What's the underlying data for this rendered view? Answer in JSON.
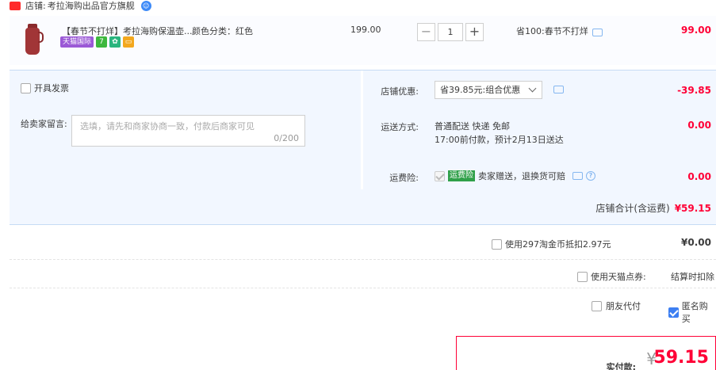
{
  "store": {
    "label": "店铺:",
    "name": "考拉海购出品官方旗舰",
    "ww_icon": "chat-bubble-icon"
  },
  "item": {
    "title": "【春节不打烊】考拉海购保温壶...",
    "sku": "颜色分类：红色",
    "tags": {
      "tmall_intl": "天猫国际",
      "seven": "7",
      "green": "✿",
      "yellow": "▭"
    },
    "price": "199.00",
    "qty": "1",
    "minus": "−",
    "plus": "+",
    "promo": "省100:春节不打烊",
    "subtotal": "99.00"
  },
  "options": {
    "invoice_label": "开具发票",
    "message_label": "给卖家留言:",
    "message_placeholder": "选填，请先和商家协商一致，付款后商家可见",
    "message_count": "0/200",
    "store_coupon_label": "店铺优惠:",
    "store_coupon_value": "省39.85元:组合优惠",
    "store_coupon_amount": "-39.85",
    "shipping_label": "运送方式:",
    "shipping_line1": "普通配送 快递 免邮",
    "shipping_line2": "17:00前付款，预计2月13日送达",
    "shipping_amount": "0.00",
    "insurance_label": "运费险:",
    "insurance_tag": "运费险",
    "insurance_text": "卖家赠送，退换货可赔",
    "insurance_amount": "0.00",
    "store_total_label": "店铺合计(含运费)",
    "store_total_amount": "¥59.15"
  },
  "coins": {
    "label": "使用297淘金币抵扣2.97元",
    "amount": "¥0.00"
  },
  "tmall_coupon": {
    "label": "使用天猫点券:",
    "settle": "结算时扣除"
  },
  "extra": {
    "friend_pay": "朋友代付",
    "anonymous": "匿名购买"
  },
  "payment": {
    "label": "实付款:",
    "currency": "¥",
    "amount": "59.15"
  },
  "colors": {
    "accent_red": "#ff0036",
    "panel_bg": "#f2f7ff",
    "checkbox_blue": "#3d7ff2"
  }
}
